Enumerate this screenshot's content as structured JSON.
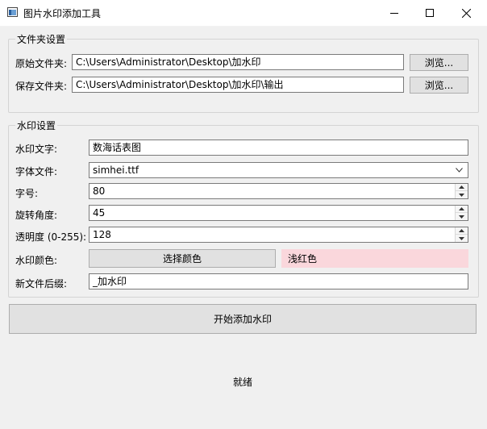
{
  "window": {
    "title": "图片水印添加工具",
    "icon": "app-window-icon",
    "controls": [
      "minimize-icon",
      "maximize-icon",
      "close-icon"
    ]
  },
  "folder_group": {
    "title": "文件夹设置",
    "source_label": "原始文件夹:",
    "source_value": "C:\\Users\\Administrator\\Desktop\\加水印",
    "source_browse": "浏览...",
    "output_label": "保存文件夹:",
    "output_value": "C:\\Users\\Administrator\\Desktop\\加水印\\输出",
    "output_browse": "浏览..."
  },
  "watermark_group": {
    "title": "水印设置",
    "text_label": "水印文字:",
    "text_value": "数海话表图",
    "font_label": "字体文件:",
    "font_value": "simhei.ttf",
    "size_label": "字号:",
    "size_value": "80",
    "rotation_label": "旋转角度:",
    "rotation_value": "45",
    "opacity_label": "透明度 (0-255):",
    "opacity_value": "128",
    "color_label": "水印颜色:",
    "color_button": "选择颜色",
    "color_preview": "浅红色",
    "color_preview_bg": "#fad7dc",
    "suffix_label": "新文件后缀:",
    "suffix_value": "_加水印"
  },
  "start_button": "开始添加水印",
  "status": "就绪"
}
